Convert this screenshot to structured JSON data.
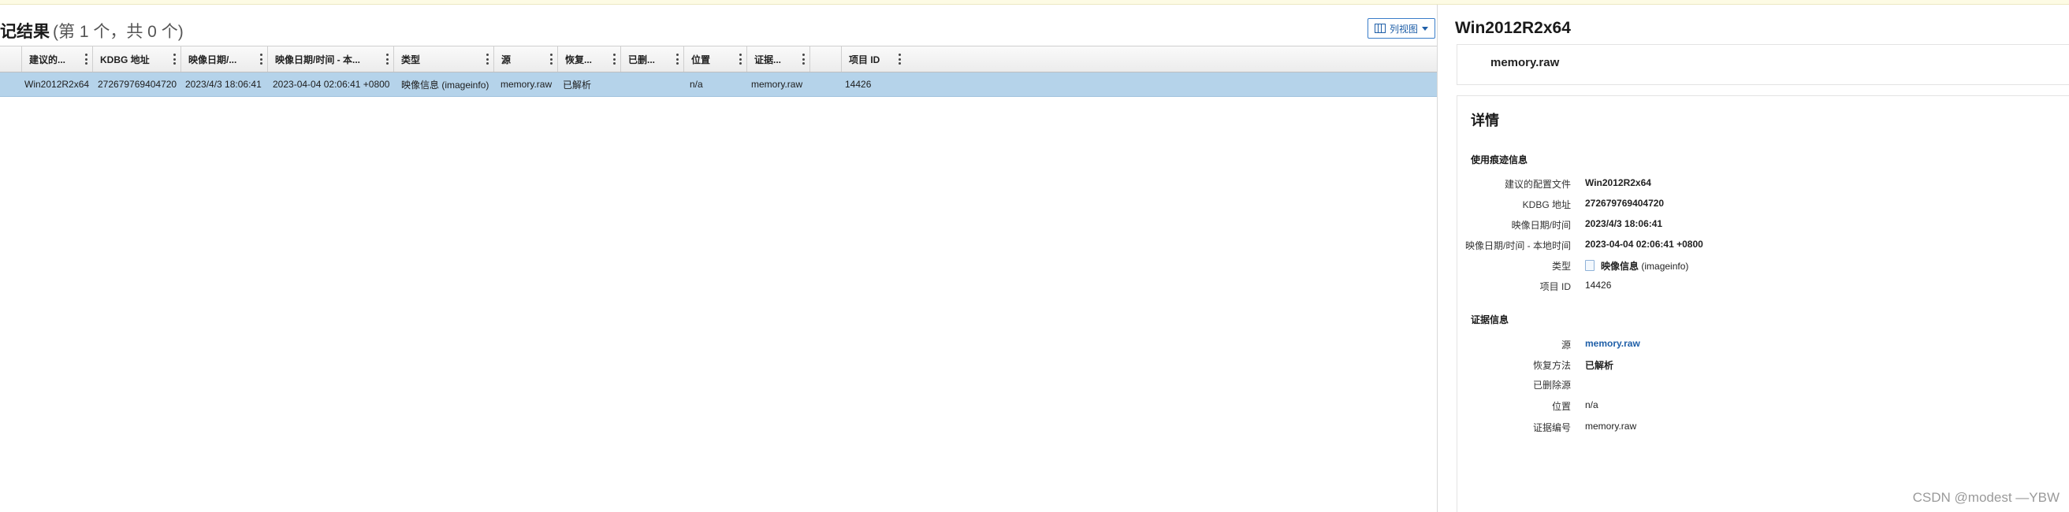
{
  "results": {
    "title": "记结果",
    "count_text": "(第 1 个，共 0 个)",
    "view_button_label": "列视图"
  },
  "grid": {
    "columns": [
      "建议的...",
      "KDBG 地址",
      "映像日期/...",
      "映像日期/时间 - 本...",
      "类型",
      "源",
      "恢复...",
      "已删...",
      "位置",
      "证据...",
      "",
      "项目 ID"
    ],
    "row": [
      "Win2012R2x64",
      "272679769404720",
      "2023/4/3 18:06:41",
      "2023-04-04 02:06:41 +0800",
      "映像信息 (imageinfo)",
      "memory.raw",
      "已解析",
      "",
      "n/a",
      "memory.raw",
      "",
      "14426"
    ]
  },
  "detail": {
    "title": "Win2012R2x64",
    "file_name": "memory.raw",
    "card_title": "详情",
    "usage_section": "使用痕迹信息",
    "usage_fields": [
      {
        "label": "建议的配置文件",
        "value": "Win2012R2x64"
      },
      {
        "label": "KDBG 地址",
        "value": "272679769404720"
      },
      {
        "label": "映像日期/时间",
        "value": "2023/4/3 18:06:41"
      },
      {
        "label": "映像日期/时间 - 本地时间",
        "value": "2023-04-04 02:06:41 +0800"
      },
      {
        "label": "类型",
        "value": "映像信息",
        "value_suffix": "(imageinfo)"
      },
      {
        "label": "项目 ID",
        "value": "14426"
      }
    ],
    "evidence_section": "证据信息",
    "evidence_fields": [
      {
        "label": "源",
        "value": "memory.raw"
      },
      {
        "label": "恢复方法",
        "value": "已解析"
      },
      {
        "label": "已删除源",
        "value": ""
      },
      {
        "label": "位置",
        "value": "n/a"
      },
      {
        "label": "证据编号",
        "value": "memory.raw"
      }
    ]
  },
  "watermark": "CSDN @modest —YBW",
  "colors": {
    "selected_row": "#b5d3ea",
    "accent": "#1f5fa8"
  },
  "icons": {
    "view_button": "columns-icon",
    "dropdown": "caret-down-icon",
    "column_menu": "kebab-icon",
    "type": "document-icon"
  }
}
